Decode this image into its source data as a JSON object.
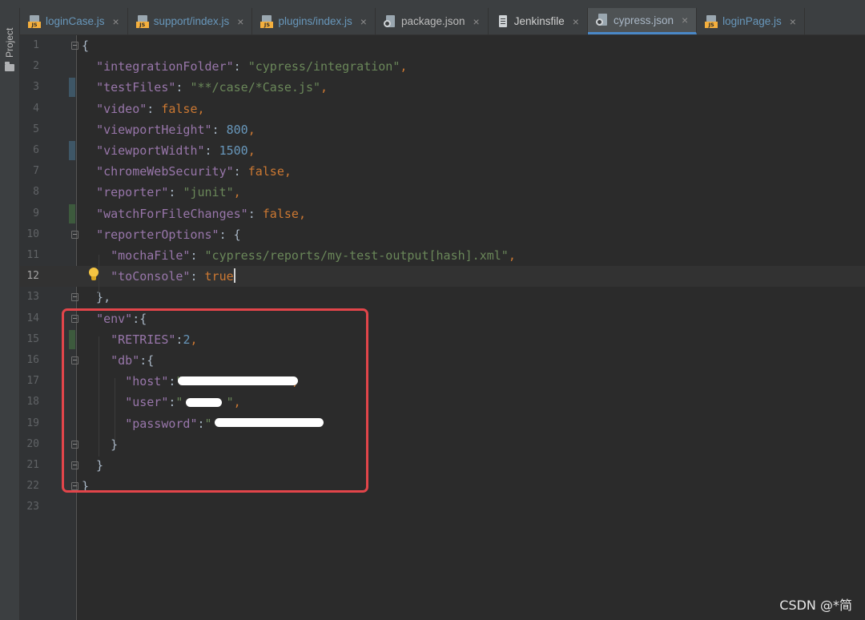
{
  "side_panel": {
    "label": "Project"
  },
  "tabs": [
    {
      "label": "loginCase.js",
      "icon": "js-file-icon",
      "kind": "js"
    },
    {
      "label": "support/index.js",
      "icon": "js-file-icon",
      "kind": "js"
    },
    {
      "label": "plugins/index.js",
      "icon": "js-file-icon",
      "kind": "js"
    },
    {
      "label": "package.json",
      "icon": "json-file-icon",
      "kind": "json"
    },
    {
      "label": "Jenkinsfile",
      "icon": "text-file-icon",
      "kind": "plain"
    },
    {
      "label": "cypress.json",
      "icon": "json-file-icon",
      "kind": "json",
      "active": true
    },
    {
      "label": "loginPage.js",
      "icon": "js-file-icon",
      "kind": "js"
    }
  ],
  "close_glyph": "×",
  "current_line": 12,
  "lines": [
    {
      "n": "1",
      "code": [
        [
          "p",
          "{"
        ]
      ]
    },
    {
      "n": "2",
      "code": [
        [
          "p",
          "  "
        ],
        [
          "key",
          "\"integrationFolder\""
        ],
        [
          "p",
          ": "
        ],
        [
          "str",
          "\"cypress/integration\""
        ],
        [
          "k",
          ","
        ]
      ]
    },
    {
      "n": "3",
      "code": [
        [
          "p",
          "  "
        ],
        [
          "key",
          "\"testFiles\""
        ],
        [
          "p",
          ": "
        ],
        [
          "str",
          "\"**/case/*Case.js\""
        ],
        [
          "k",
          ","
        ]
      ]
    },
    {
      "n": "4",
      "code": [
        [
          "p",
          "  "
        ],
        [
          "key",
          "\"video\""
        ],
        [
          "p",
          ": "
        ],
        [
          "kw",
          "false"
        ],
        [
          "k",
          ","
        ]
      ]
    },
    {
      "n": "5",
      "code": [
        [
          "p",
          "  "
        ],
        [
          "key",
          "\"viewportHeight\""
        ],
        [
          "p",
          ": "
        ],
        [
          "num",
          "800"
        ],
        [
          "k",
          ","
        ]
      ]
    },
    {
      "n": "6",
      "code": [
        [
          "p",
          "  "
        ],
        [
          "key",
          "\"viewportWidth\""
        ],
        [
          "p",
          ": "
        ],
        [
          "num",
          "1500"
        ],
        [
          "k",
          ","
        ]
      ]
    },
    {
      "n": "7",
      "code": [
        [
          "p",
          "  "
        ],
        [
          "key",
          "\"chromeWebSecurity\""
        ],
        [
          "p",
          ": "
        ],
        [
          "kw",
          "false"
        ],
        [
          "k",
          ","
        ]
      ]
    },
    {
      "n": "8",
      "code": [
        [
          "p",
          "  "
        ],
        [
          "key",
          "\"reporter\""
        ],
        [
          "p",
          ": "
        ],
        [
          "str",
          "\"junit\""
        ],
        [
          "k",
          ","
        ]
      ]
    },
    {
      "n": "9",
      "code": [
        [
          "p",
          "  "
        ],
        [
          "key",
          "\"watchForFileChanges\""
        ],
        [
          "p",
          ": "
        ],
        [
          "kw",
          "false"
        ],
        [
          "k",
          ","
        ]
      ]
    },
    {
      "n": "10",
      "code": [
        [
          "p",
          "  "
        ],
        [
          "key",
          "\"reporterOptions\""
        ],
        [
          "p",
          ": {"
        ]
      ]
    },
    {
      "n": "11",
      "code": [
        [
          "p",
          "    "
        ],
        [
          "key",
          "\"mochaFile\""
        ],
        [
          "p",
          ": "
        ],
        [
          "str",
          "\"cypress/reports/my-test-output[hash].xml\""
        ],
        [
          "k",
          ","
        ]
      ]
    },
    {
      "n": "12",
      "code": [
        [
          "p",
          "    "
        ],
        [
          "key",
          "\"toConsole\""
        ],
        [
          "p",
          ": "
        ],
        [
          "kw",
          "true"
        ]
      ]
    },
    {
      "n": "13",
      "code": [
        [
          "p",
          "  },"
        ]
      ]
    },
    {
      "n": "14",
      "code": [
        [
          "p",
          "  "
        ],
        [
          "key",
          "\"env\""
        ],
        [
          "p",
          ":{"
        ]
      ]
    },
    {
      "n": "15",
      "code": [
        [
          "p",
          "    "
        ],
        [
          "key",
          "\"RETRIES\""
        ],
        [
          "p",
          ":"
        ],
        [
          "num",
          "2"
        ],
        [
          "k",
          ","
        ]
      ]
    },
    {
      "n": "16",
      "code": [
        [
          "p",
          "    "
        ],
        [
          "key",
          "\"db\""
        ],
        [
          "p",
          ":{"
        ]
      ]
    },
    {
      "n": "17",
      "code": [
        [
          "p",
          "      "
        ],
        [
          "key",
          "\"host\""
        ],
        [
          "p",
          ":"
        ],
        [
          "str",
          "\"              \""
        ],
        [
          "k",
          ","
        ]
      ]
    },
    {
      "n": "18",
      "code": [
        [
          "p",
          "      "
        ],
        [
          "key",
          "\"user\""
        ],
        [
          "p",
          ":"
        ],
        [
          "str",
          "\"      \""
        ],
        [
          "k",
          ","
        ]
      ]
    },
    {
      "n": "19",
      "code": [
        [
          "p",
          "      "
        ],
        [
          "key",
          "\"password\""
        ],
        [
          "p",
          ":"
        ],
        [
          "str",
          "\"              \""
        ]
      ]
    },
    {
      "n": "20",
      "code": [
        [
          "p",
          "    }"
        ]
      ]
    },
    {
      "n": "21",
      "code": [
        [
          "p",
          "  }"
        ]
      ]
    },
    {
      "n": "22",
      "code": [
        [
          "p",
          "}"
        ]
      ]
    },
    {
      "n": "23",
      "code": []
    }
  ],
  "watermark": "CSDN @*简"
}
